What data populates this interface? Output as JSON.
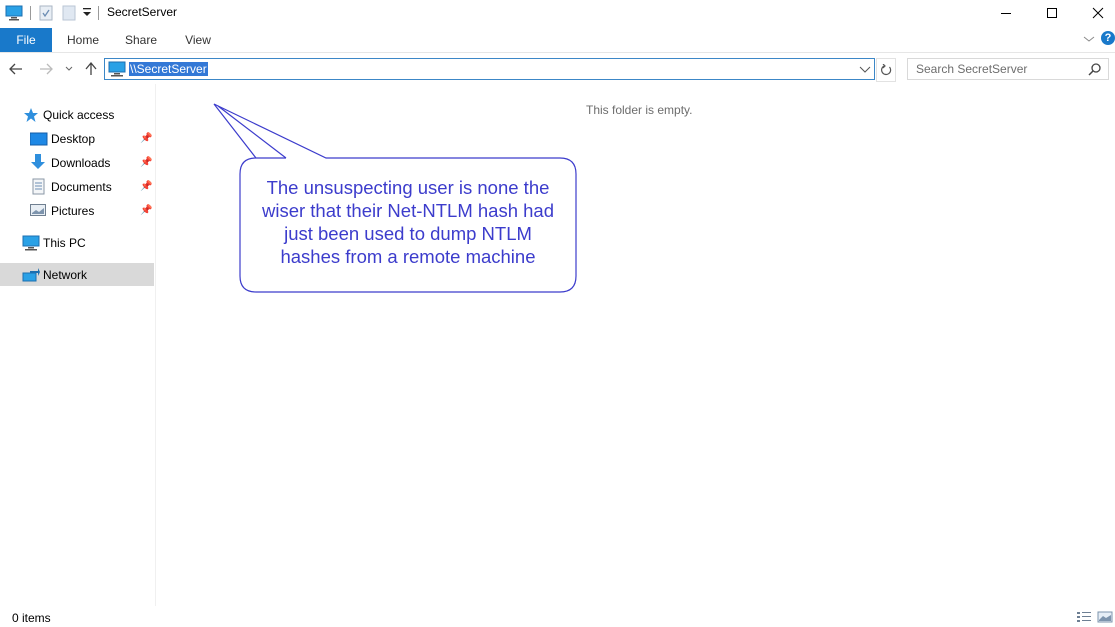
{
  "window": {
    "title": "SecretServer",
    "controls": {
      "minimize": "minimize-icon",
      "maximize": "maximize-icon",
      "close": "close-icon"
    }
  },
  "qat": {
    "icons": [
      "computer-icon",
      "properties-icon",
      "new-folder-icon",
      "customize-dropdown-icon"
    ]
  },
  "ribbon": {
    "tabs": [
      {
        "label": "File",
        "active": true
      },
      {
        "label": "Home"
      },
      {
        "label": "Share"
      },
      {
        "label": "View"
      }
    ],
    "expand_icon": "chevron-down-icon",
    "help_icon": "help-icon",
    "help_label": "?"
  },
  "navigation": {
    "back_icon": "back-arrow-icon",
    "forward_icon": "forward-arrow-icon",
    "recent_icon": "chevron-down-icon",
    "up_icon": "up-arrow-icon",
    "address": "\\\\SecretServer",
    "refresh_icon": "refresh-icon",
    "search_placeholder": "Search SecretServer"
  },
  "sidebar": {
    "quick_access": "Quick access",
    "items": [
      {
        "label": "Desktop",
        "icon": "desktop-icon",
        "pinned": true
      },
      {
        "label": "Downloads",
        "icon": "downloads-icon",
        "pinned": true
      },
      {
        "label": "Documents",
        "icon": "documents-icon",
        "pinned": true
      },
      {
        "label": "Pictures",
        "icon": "pictures-icon",
        "pinned": true
      }
    ],
    "this_pc": "This PC",
    "network": "Network"
  },
  "content": {
    "empty_message": "This folder is empty.",
    "callout": "The unsuspecting user is none the wiser that their Net-NTLM hash had just been used to dump NTLM hashes from a remote machine",
    "callout_lines": [
      "The unsuspecting user is none the",
      "wiser that their Net-NTLM hash had",
      "just been used to dump NTLM",
      "hashes from a remote machine"
    ]
  },
  "status": {
    "items": "0 items",
    "view_icons": [
      "details-view-icon",
      "large-icons-view-icon"
    ]
  },
  "colors": {
    "accent": "#1979ca",
    "selection": "#3378d6",
    "callout": "#3c3ccc",
    "nav_selected": "#d9d9d9"
  }
}
